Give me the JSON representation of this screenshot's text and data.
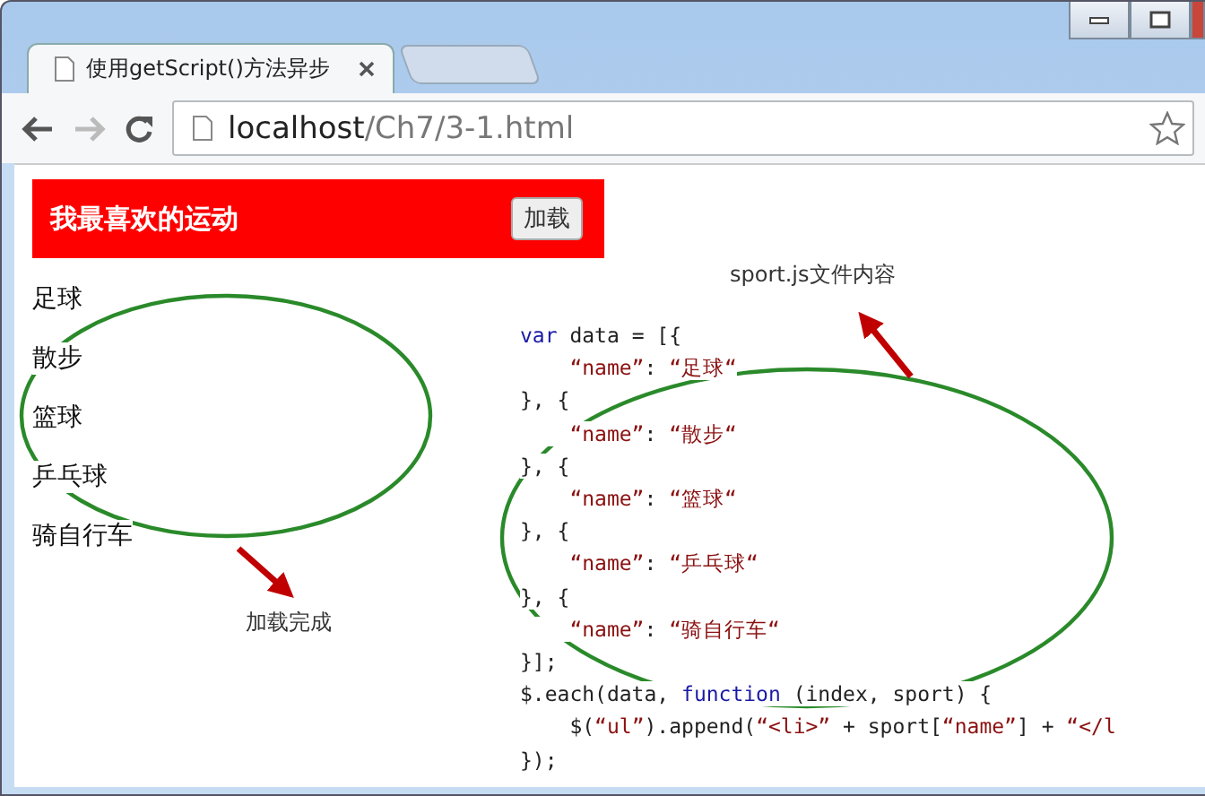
{
  "tabs": [
    {
      "label": "使用getScript()方法异步",
      "selected": true
    }
  ],
  "address": {
    "host": "localhost",
    "path": "/Ch7/3-1.html"
  },
  "page": {
    "heading": "我最喜欢的运动",
    "load_button": "加载",
    "sports": [
      "足球",
      "散步",
      "篮球",
      "乒乓球",
      "骑自行车"
    ]
  },
  "code_lines": [
    [
      {
        "kind": "keyword",
        "text": "var"
      },
      {
        "kind": "plain",
        "text": " data = [{"
      }
    ],
    [
      {
        "kind": "string",
        "text": "    “name”"
      },
      {
        "kind": "plain",
        "text": ": "
      },
      {
        "kind": "string",
        "text": "“足球“"
      }
    ],
    [
      {
        "kind": "plain",
        "text": "}, {"
      }
    ],
    [
      {
        "kind": "string",
        "text": "    “name”"
      },
      {
        "kind": "plain",
        "text": ": "
      },
      {
        "kind": "string",
        "text": "“散步“"
      }
    ],
    [
      {
        "kind": "plain",
        "text": "}, {"
      }
    ],
    [
      {
        "kind": "string",
        "text": "    “name”"
      },
      {
        "kind": "plain",
        "text": ": "
      },
      {
        "kind": "string",
        "text": "“篮球“"
      }
    ],
    [
      {
        "kind": "plain",
        "text": "}, {"
      }
    ],
    [
      {
        "kind": "string",
        "text": "    “name”"
      },
      {
        "kind": "plain",
        "text": ": "
      },
      {
        "kind": "string",
        "text": "“乒乓球“"
      }
    ],
    [
      {
        "kind": "plain",
        "text": "}, {"
      }
    ],
    [
      {
        "kind": "string",
        "text": "    “name”"
      },
      {
        "kind": "plain",
        "text": ": "
      },
      {
        "kind": "string",
        "text": "“骑自行车“"
      }
    ],
    [
      {
        "kind": "plain",
        "text": "}];"
      }
    ],
    [
      {
        "kind": "plain",
        "text": "$.each(data, "
      },
      {
        "kind": "keyword",
        "text": "function"
      },
      {
        "kind": "plain",
        "text": " (index, sport) {"
      }
    ],
    [
      {
        "kind": "plain",
        "text": "    $("
      },
      {
        "kind": "string",
        "text": "“ul”"
      },
      {
        "kind": "plain",
        "text": ").append("
      },
      {
        "kind": "string",
        "text": "“<li>”"
      },
      {
        "kind": "plain",
        "text": " + sport["
      },
      {
        "kind": "string",
        "text": "“name”"
      },
      {
        "kind": "plain",
        "text": "] + "
      },
      {
        "kind": "string",
        "text": "“</l"
      }
    ],
    [
      {
        "kind": "plain",
        "text": "});"
      }
    ]
  ],
  "annotations": {
    "file_label": "sport.js文件内容",
    "done_label": "加载完成"
  }
}
